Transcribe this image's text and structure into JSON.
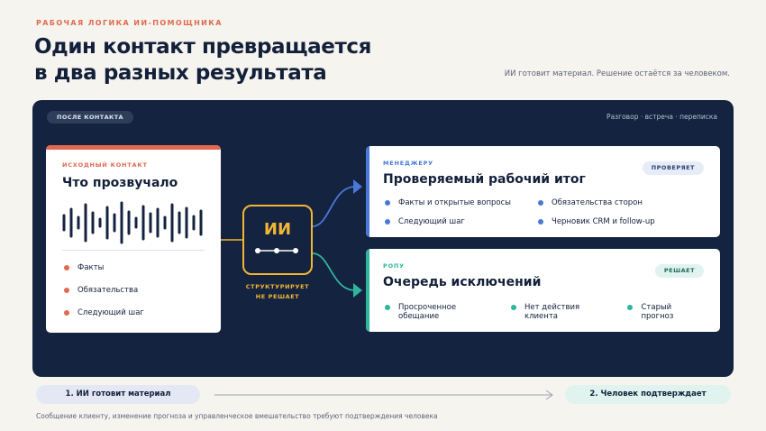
{
  "header": {
    "eyebrow": "РАБОЧАЯ ЛОГИКА ИИ-ПОМОЩНИКА",
    "title_line1": "Один контакт превращается",
    "title_line2": "в два разных результата",
    "tagline": "ИИ готовит материал. Решение остаётся за человеком."
  },
  "panel": {
    "pill": "ПОСЛЕ КОНТАКТА",
    "note": "Разговор · встреча · переписка"
  },
  "source": {
    "label": "ИСХОДНЫЙ КОНТАКТ",
    "title": "Что прозвучало",
    "items": [
      "Факты",
      "Обязательства",
      "Следующий шаг"
    ]
  },
  "ai": {
    "label": "ИИ",
    "caption_line1": "СТРУКТУРИРУЕТ",
    "caption_line2": "НЕ РЕШАЕТ"
  },
  "manager": {
    "label": "МЕНЕДЖЕРУ",
    "title": "Проверяемый рабочий итог",
    "badge": "ПРОВЕРЯЕТ",
    "items": [
      "Факты и открытые вопросы",
      "Обязательства сторон",
      "Следующий шаг",
      "Черновик CRM и follow-up"
    ]
  },
  "rop": {
    "label": "РОПУ",
    "title": "Очередь исключений",
    "badge": "РЕШАЕТ",
    "items": [
      "Просроченное обещание",
      "Нет действия клиента",
      "Старый прогноз"
    ]
  },
  "flow": {
    "step1": "1. ИИ готовит материал",
    "step2": "2. Человек подтверждает"
  },
  "footnote": "Сообщение клиенту, изменение прогноза и управленческое вмешательство требуют подтверждения человека",
  "colors": {
    "accent_coral": "#e0694f",
    "accent_blue": "#4a78d8",
    "accent_teal": "#2fb59b",
    "accent_gold": "#f2b634",
    "panel_navy": "#14233f"
  }
}
